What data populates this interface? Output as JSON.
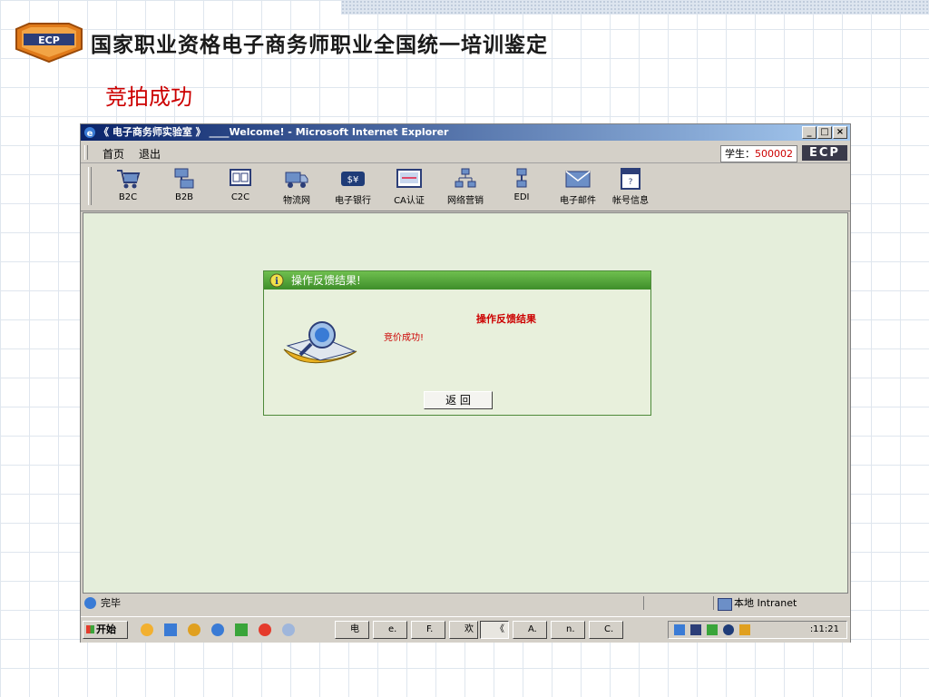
{
  "slide": {
    "title": "国家职业资格电子商务师职业全国统一培训鉴定",
    "subtitle": "竞拍成功",
    "logo_text": "ECP"
  },
  "browser": {
    "title": "《 电子商务师实验室 》 ____Welcome! - Microsoft Internet Explorer",
    "menu": [
      "首页",
      "退出"
    ],
    "student_label": "学生：",
    "student_id": "500002",
    "badge": "ECP",
    "toolbar": [
      {
        "label": "B2C",
        "icon": "cart-icon"
      },
      {
        "label": "B2B",
        "icon": "network-computers-icon"
      },
      {
        "label": "C2C",
        "icon": "c2c-monitor-icon"
      },
      {
        "label": "物流网",
        "icon": "truck-icon"
      },
      {
        "label": "电子银行",
        "icon": "bank-money-icon"
      },
      {
        "label": "CA认证",
        "icon": "certificate-icon"
      },
      {
        "label": "网络营销",
        "icon": "org-chart-icon"
      },
      {
        "label": "EDI",
        "icon": "edi-icon"
      },
      {
        "label": "电子邮件",
        "icon": "email-icon"
      },
      {
        "label": "帐号信息",
        "icon": "help-account-icon"
      }
    ],
    "status_left": "完毕",
    "status_zone": "本地 Intranet"
  },
  "dialog": {
    "title": "操作反馈结果!",
    "heading": "操作反馈结果",
    "message": "竞价成功!",
    "back_button": "返 回"
  },
  "taskbar": {
    "start": "开始",
    "items": [
      "电",
      "e.",
      "F.",
      "欢",
      "《",
      "A.",
      "n.",
      "C."
    ],
    "clock": ":11:21"
  },
  "colors": {
    "accent_red": "#cc0000",
    "dialog_green": "#3e8e2a",
    "content_bg": "#e5eedb",
    "titlebar_blue": "#0a246a"
  }
}
